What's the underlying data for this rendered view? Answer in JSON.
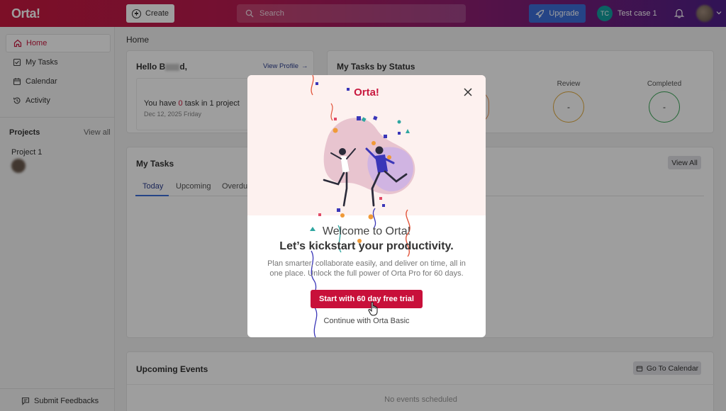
{
  "topbar": {
    "logo": "Orta!",
    "create_label": "Create",
    "search_placeholder": "Search",
    "upgrade_label": "Upgrade",
    "user_initials": "TC",
    "user_name": "Test case 1"
  },
  "sidebar": {
    "items": [
      {
        "label": "Home",
        "icon": "home-icon",
        "active": true
      },
      {
        "label": "My Tasks",
        "icon": "checkbox-icon",
        "active": false
      },
      {
        "label": "Calendar",
        "icon": "calendar-icon",
        "active": false
      },
      {
        "label": "Activity",
        "icon": "history-icon",
        "active": false
      }
    ],
    "projects_title": "Projects",
    "projects_view_all": "View all",
    "projects": [
      {
        "name": "Project 1"
      }
    ],
    "feedback_label": "Submit Feedbacks"
  },
  "main": {
    "breadcrumb": "Home",
    "hello_prefix": "Hello B",
    "hello_suffix": "d,",
    "view_profile": "View Profile",
    "task_prefix": "You have ",
    "task_count": "0",
    "task_suffix": " task in 1 project",
    "date": "Dec 12, 2025 Friday",
    "status_title": "My Tasks by Status",
    "status_partial": "s",
    "statuses": [
      {
        "label": "Review",
        "value": "-",
        "color": "#e0a93a"
      },
      {
        "label": "Completed",
        "value": "-",
        "color": "#3aa657"
      }
    ],
    "my_tasks_title": "My Tasks",
    "view_all_btn": "View All",
    "tabs": [
      "Today",
      "Upcoming",
      "Overdue"
    ],
    "events_title": "Upcoming Events",
    "go_to_calendar": "Go To Calendar",
    "no_events": "No events scheduled"
  },
  "modal": {
    "logo": "Orta!",
    "welcome": "Welcome to Orta!",
    "headline": "Let’s kickstart your productivity.",
    "description": "Plan smarter, collaborate easily, and deliver on time, all in one place. Unlock the full power of Orta Pro for 60 days.",
    "primary_button": "Start with 60 day free trial",
    "secondary_link": "Continue with Orta Basic"
  },
  "colors": {
    "brand": "#c8193f",
    "upgrade": "#3c6fd9"
  }
}
